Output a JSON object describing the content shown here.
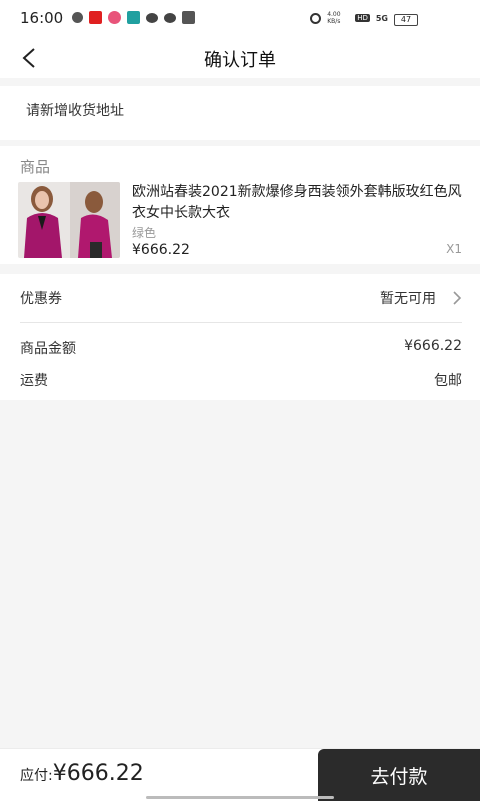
{
  "status": {
    "time": "16:00",
    "net_speed": "4.00 KB/s",
    "hd": "HD",
    "signal": "5G",
    "battery": "47"
  },
  "nav": {
    "title": "确认订单"
  },
  "address": {
    "prompt": "请新增收货地址"
  },
  "goods": {
    "header": "商品",
    "name": "欧洲站春装2021新款爆修身西装领外套韩版玫红色风衣女中长款大衣",
    "spec": "绿色",
    "price": "¥666.22",
    "qty": "X1"
  },
  "fees": {
    "coupon_label": "优惠券",
    "coupon_value": "暂无可用",
    "amount_label": "商品金额",
    "amount_value": "¥666.22",
    "shipping_label": "运费",
    "shipping_value": "包邮"
  },
  "bottom": {
    "total_label": "应付:",
    "total_value": "¥666.22",
    "pay_button": "去付款"
  },
  "colors": {
    "accent_product": "#b0186e",
    "pay_button_bg": "#2b2b2b"
  }
}
